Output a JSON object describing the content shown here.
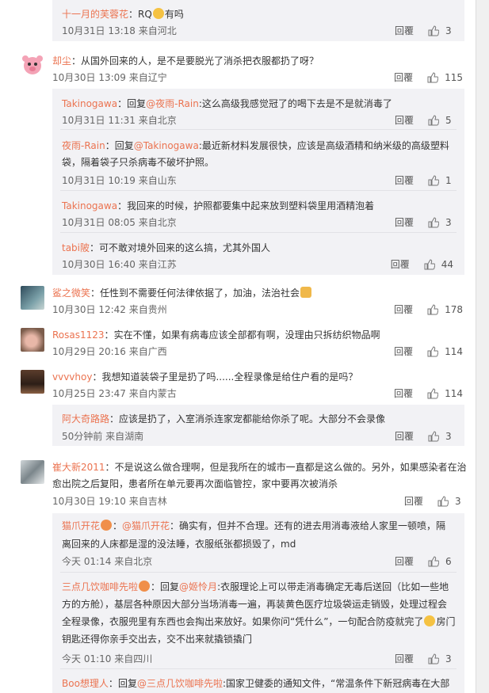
{
  "ui": {
    "reply_label": "回覆"
  },
  "comments": [
    {
      "id": "c0",
      "nick": "十一月的芙蓉花",
      "sep": "：",
      "text_before": "RQ",
      "emoji": "emoji",
      "text_after": "有吗",
      "meta": "10月31日 13:18 来自河北",
      "likes": "3"
    },
    {
      "id": "c1",
      "nick": "却尘",
      "sep": "：",
      "text": "从国外回来的人，是不是要脱光了消杀把衣服都扔了呀？",
      "meta": "10月30日 13:09 来自辽宁",
      "likes": "115"
    },
    {
      "id": "c1r1",
      "nick": "Takinogawa",
      "sep": "：",
      "reply_prefix": "回复",
      "reply_to": "@夜雨-Rain",
      "text": ":这么高级我感觉冠了的喝下去是不是就消毒了",
      "meta": "10月31日 11:31 来自北京",
      "likes": "5"
    },
    {
      "id": "c1r2",
      "nick": "夜雨-Rain",
      "sep": "：",
      "reply_prefix": "回复",
      "reply_to": "@Takinogawa",
      "text1": ":最近新材料发展很快，应该是高级酒精和纳米级的高级塑料",
      "text2": "袋，隔着袋子只杀病毒不破坏护照。",
      "meta": "10月31日 10:19 来自山东",
      "likes": "1"
    },
    {
      "id": "c1r3",
      "nick": "Takinogawa",
      "sep": "：",
      "text": "我回来的时候，护照都要集中起来放到塑料袋里用酒精泡着",
      "meta": "10月31日 08:05 来自北京",
      "likes": "3"
    },
    {
      "id": "c1r4",
      "nick": "tabi陂",
      "sep": "：",
      "text": "可不敢对境外回来的这么搞，尤其外国人",
      "meta": "10月30日 16:40 来自江苏",
      "likes": "44"
    },
    {
      "id": "c2",
      "nick": "鲨之微笑",
      "sep": "：",
      "text": "任性到不需要任何法律依据了，加油，法治社会",
      "meta": "10月30日 12:42 来自贵州",
      "likes": "178"
    },
    {
      "id": "c3",
      "nick": "Rosas1123",
      "sep": "：",
      "text": "实在不懂，如果有病毒应该全部都有啊，没理由只拆纺织物品啊",
      "meta": "10月29日 20:16 来自广西",
      "likes": "114"
    },
    {
      "id": "c4",
      "nick": "vvvvhoy",
      "sep": "：",
      "text": "我想知道装袋子里是扔了吗......全程录像是给住户看的是吗？",
      "meta": "10月25日 23:47 来自内蒙古",
      "likes": "114"
    },
    {
      "id": "c4r1",
      "nick": "阿大奇路路",
      "sep": "：",
      "text": "应该是扔了，入室消杀连家宠都能给你杀了呢。大部分不会录像",
      "meta": "50分钟前 来自湖南",
      "likes": "3"
    },
    {
      "id": "c5",
      "nick": "崔大新2011",
      "sep": "：",
      "text1": "不是说这么做合理啊，但是我所在的城市一直都是这么做的。另外，如果感染者在治",
      "text2": "愈出院之后复阳，患者所在单元要再次面临管控，家中要再次被消杀",
      "meta": "10月30日 19:10 来自吉林",
      "likes": "3"
    },
    {
      "id": "c5r1",
      "nick": "猫爪开花",
      "sep": "：",
      "reply_to": "@猫爪开花",
      "text1": "：确实有，但并不合理。还有的进去用消毒液给人家里一顿喷，隔",
      "text2": "离回来的人床都是湿的没法睡，衣服纸张都损毁了，md",
      "meta": "今天 01:14 来自北京",
      "likes": "6"
    },
    {
      "id": "c5r2",
      "nick": "三点几饮咖啡先啦",
      "sep": "：",
      "reply_prefix": "回复",
      "reply_to": "@姬怜月",
      "text1": ":衣服理论上可以带走消毒确定无毒后送回（比如一些地",
      "text2": "方的方舱），基层各种原因大部分当场消毒一遍，再装黄色医疗垃圾袋运走销毁，处理过程会",
      "text3": "全程录像，衣服兜里有东西也会掏出来放好。如果你问“凭什么”，一句配合防疫就完了",
      "text4": "房门",
      "text5": "钥匙还得你亲手交出去，交不出来就撬锁撬门",
      "meta": "今天 01:10 来自四川",
      "likes": "3"
    },
    {
      "id": "c5r3",
      "nick": "Boo想理人",
      "sep": "：",
      "reply_prefix": "回复",
      "reply_to": "@三点几饮咖啡先啦",
      "text": ":国家卫健委的通知文件，“常温条件下新冠病毒在大部"
    }
  ]
}
